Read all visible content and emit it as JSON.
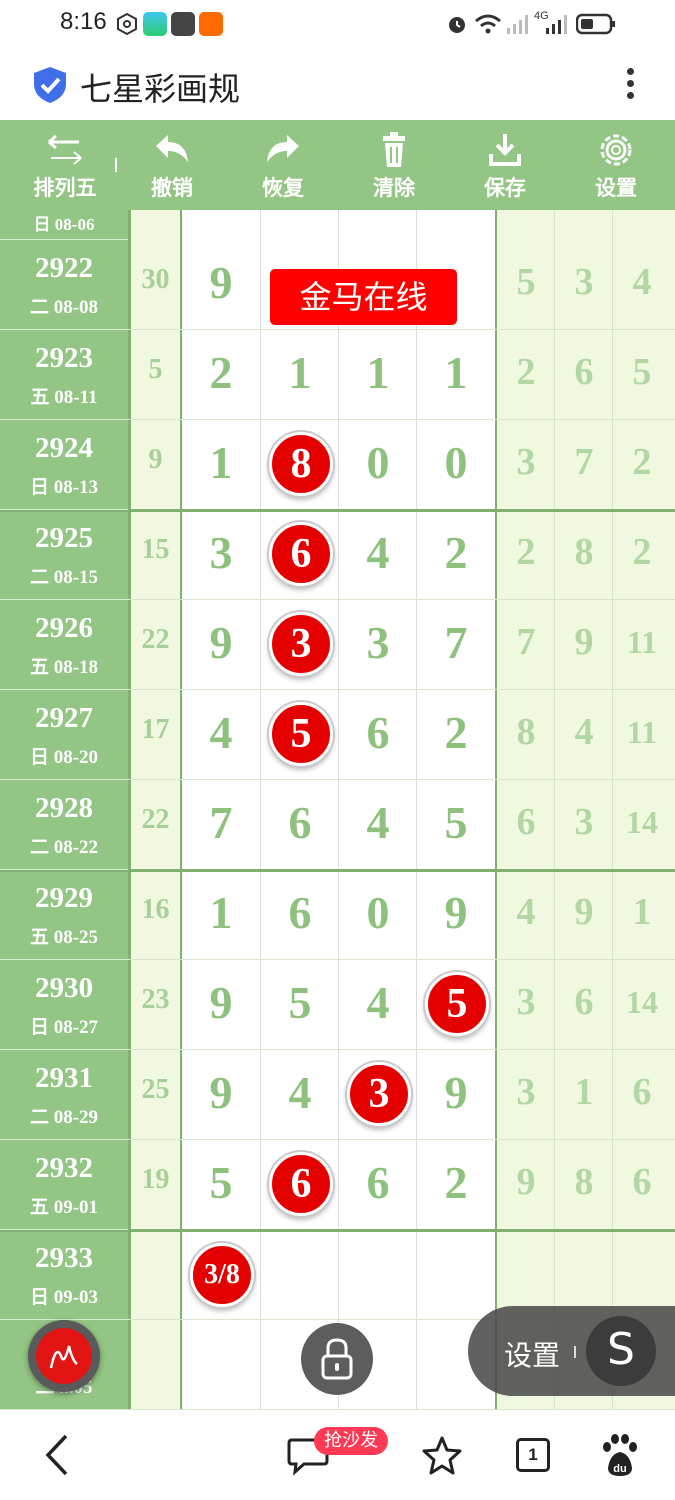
{
  "status_bar": {
    "time": "8:16",
    "network": "4G"
  },
  "app": {
    "title": "七星彩画规"
  },
  "toolbar": {
    "items": [
      {
        "label": "排列五",
        "icon": "swap-arrows-icon"
      },
      {
        "label": "撤销",
        "icon": "undo-icon"
      },
      {
        "label": "恢复",
        "icon": "redo-icon"
      },
      {
        "label": "清除",
        "icon": "trash-icon"
      },
      {
        "label": "保存",
        "icon": "download-icon"
      },
      {
        "label": "设置",
        "icon": "gear-icon"
      }
    ]
  },
  "overlay_badge": "金马在线",
  "partial_top": {
    "date": "日 08-06"
  },
  "rows": [
    {
      "issue": "2922",
      "date": "二 08-08",
      "sum": "30",
      "digits": [
        "9",
        "",
        "",
        ""
      ],
      "right": [
        "5",
        "3",
        "4"
      ],
      "ball": -1
    },
    {
      "issue": "2923",
      "date": "五 08-11",
      "sum": "5",
      "digits": [
        "2",
        "1",
        "1",
        "1"
      ],
      "right": [
        "2",
        "6",
        "5"
      ],
      "ball": -1
    },
    {
      "issue": "2924",
      "date": "日 08-13",
      "sum": "9",
      "digits": [
        "1",
        "8",
        "0",
        "0"
      ],
      "right": [
        "3",
        "7",
        "2"
      ],
      "ball": 1
    },
    {
      "issue": "2925",
      "date": "二 08-15",
      "sum": "15",
      "digits": [
        "3",
        "6",
        "4",
        "2"
      ],
      "right": [
        "2",
        "8",
        "2"
      ],
      "ball": 1
    },
    {
      "issue": "2926",
      "date": "五 08-18",
      "sum": "22",
      "digits": [
        "9",
        "3",
        "3",
        "7"
      ],
      "right": [
        "7",
        "9",
        "11"
      ],
      "ball": 1
    },
    {
      "issue": "2927",
      "date": "日 08-20",
      "sum": "17",
      "digits": [
        "4",
        "5",
        "6",
        "2"
      ],
      "right": [
        "8",
        "4",
        "11"
      ],
      "ball": 1
    },
    {
      "issue": "2928",
      "date": "二 08-22",
      "sum": "22",
      "digits": [
        "7",
        "6",
        "4",
        "5"
      ],
      "right": [
        "6",
        "3",
        "14"
      ],
      "ball": -1
    },
    {
      "issue": "2929",
      "date": "五 08-25",
      "sum": "16",
      "digits": [
        "1",
        "6",
        "0",
        "9"
      ],
      "right": [
        "4",
        "9",
        "1"
      ],
      "ball": -1
    },
    {
      "issue": "2930",
      "date": "日 08-27",
      "sum": "23",
      "digits": [
        "9",
        "5",
        "4",
        "5"
      ],
      "right": [
        "3",
        "6",
        "14"
      ],
      "ball": 3
    },
    {
      "issue": "2931",
      "date": "二 08-29",
      "sum": "25",
      "digits": [
        "9",
        "4",
        "3",
        "9"
      ],
      "right": [
        "3",
        "1",
        "6"
      ],
      "ball": 2
    },
    {
      "issue": "2932",
      "date": "五 09-01",
      "sum": "19",
      "digits": [
        "5",
        "6",
        "6",
        "2"
      ],
      "right": [
        "9",
        "8",
        "6"
      ],
      "ball": 1
    },
    {
      "issue": "2933",
      "date": "日 09-03",
      "sum": "",
      "digits": [
        "",
        "",
        "",
        ""
      ],
      "right": [
        "",
        "",
        ""
      ],
      "ball": -1
    },
    {
      "issue": "",
      "date": "二 ...05",
      "sum": "",
      "digits": [
        "",
        "",
        "",
        ""
      ],
      "right": [
        "",
        "",
        ""
      ],
      "ball": -1
    }
  ],
  "prediction": "3/8",
  "floating": {
    "settings_label": "设置",
    "s_label": "S"
  },
  "bottom_nav": {
    "promo": "抢沙发",
    "tab_count": "1"
  },
  "colors": {
    "green": "#93c584",
    "light_green": "#f0f8df",
    "red": "#e50000"
  }
}
